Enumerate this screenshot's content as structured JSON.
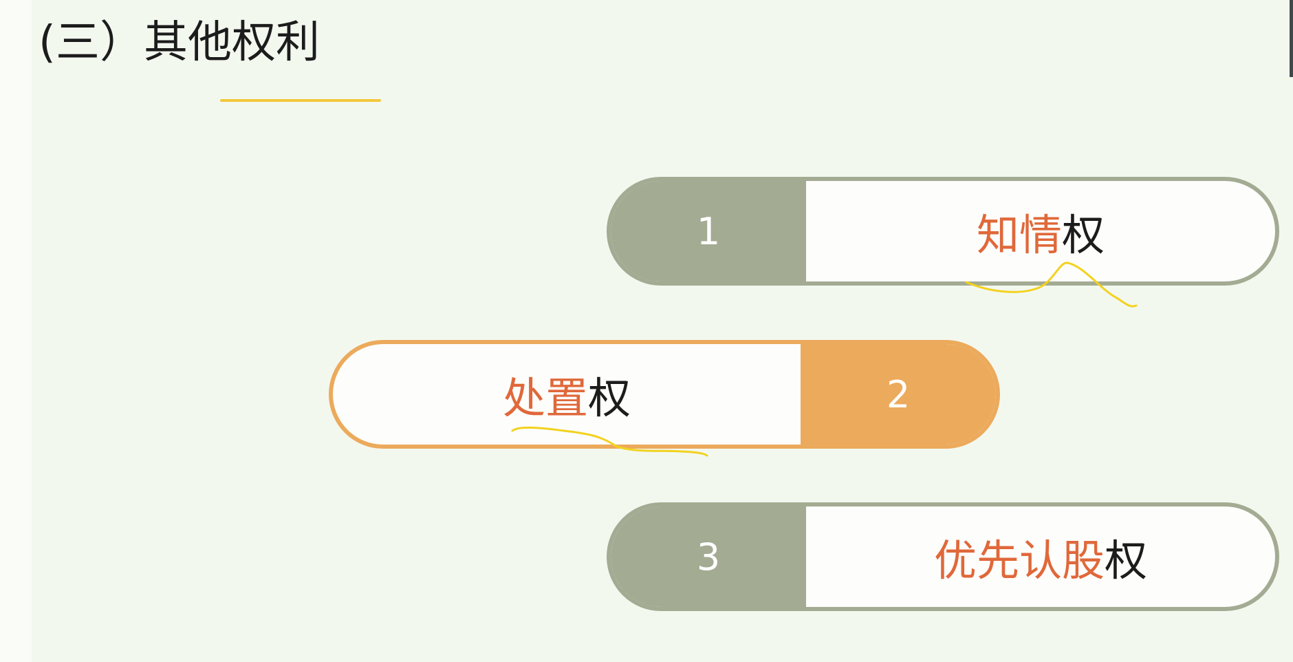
{
  "slide": {
    "title": "(三）其他权利",
    "accent_color": "#f4c73b"
  },
  "items": [
    {
      "number": "1",
      "highlight": "知情",
      "suffix": "权",
      "color": "#a3ab93"
    },
    {
      "number": "2",
      "highlight": "处置",
      "suffix": "权",
      "color": "#ecaa5c"
    },
    {
      "number": "3",
      "highlight": "优先认股",
      "suffix": "权",
      "color": "#a3ab93"
    }
  ],
  "colors": {
    "highlight_text": "#e0683a",
    "handwriting": "#f2d21f",
    "background": "#f3f8ef"
  }
}
